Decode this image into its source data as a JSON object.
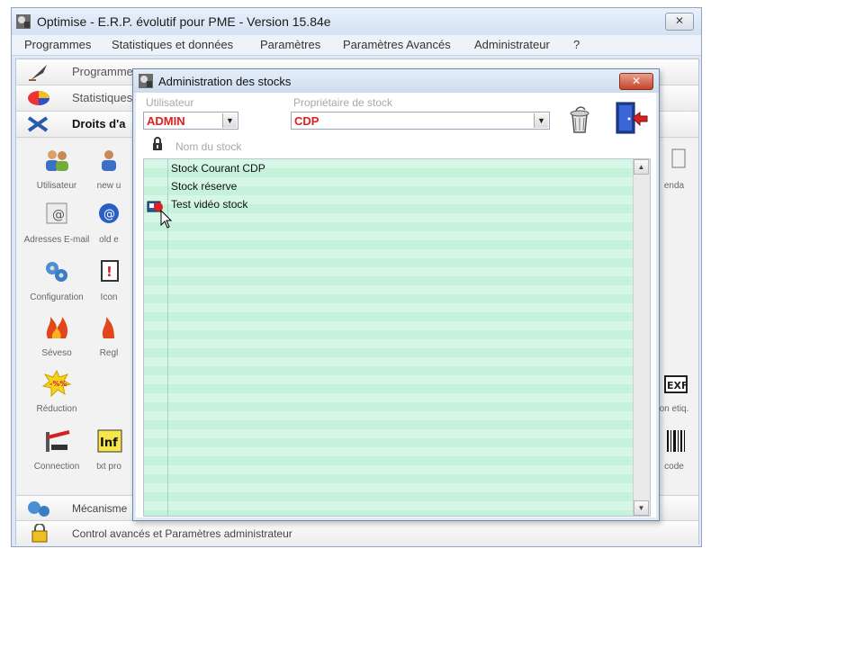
{
  "window": {
    "title": "Optimise  -  E.R.P. évolutif pour PME  -  Version 15.84e",
    "close_glyph": "✕"
  },
  "menu": {
    "items": [
      "Programmes",
      "Statistiques et données",
      "Paramètres",
      "Paramètres Avancés",
      "Administrateur",
      "?"
    ]
  },
  "sections": {
    "programmes": "Programmes",
    "statistiques": "Statistiques",
    "droits": "Droits d'a",
    "mecanisme": "Mécanisme",
    "control": "Control avancés et Paramètres administrateur"
  },
  "tools": {
    "left": [
      "Utilisateur",
      "Adresses E-mail",
      "Configuration",
      "Séveso",
      "Réduction",
      "Connection"
    ],
    "second": [
      "new u",
      "old e",
      "Icon",
      "Regl",
      "txt pro"
    ],
    "right": [
      "enda",
      "on etiq.",
      "code"
    ],
    "reduction_badge": "-%%",
    "info_badge": "Inf",
    "exf_badge": "EXF"
  },
  "dialog": {
    "title": "Administration des stocks",
    "close_glyph": "✕",
    "user_label": "Utilisateur",
    "user_value": "ADMIN",
    "owner_label": "Propriétaire de stock",
    "owner_value": "CDP",
    "column_header": "Nom du stock",
    "stocks": [
      "Stock Courant CDP",
      "Stock réserve",
      "Test vidéo stock"
    ],
    "selected_index": 2,
    "dropdown_glyph": "▼",
    "scroll_up_glyph": "▲",
    "scroll_down_glyph": "▼"
  },
  "colors": {
    "accent_red": "#e02020",
    "list_green_a": "#d7f7e6",
    "list_green_b": "#c6f1db",
    "title_blue": "#dde9f5"
  }
}
